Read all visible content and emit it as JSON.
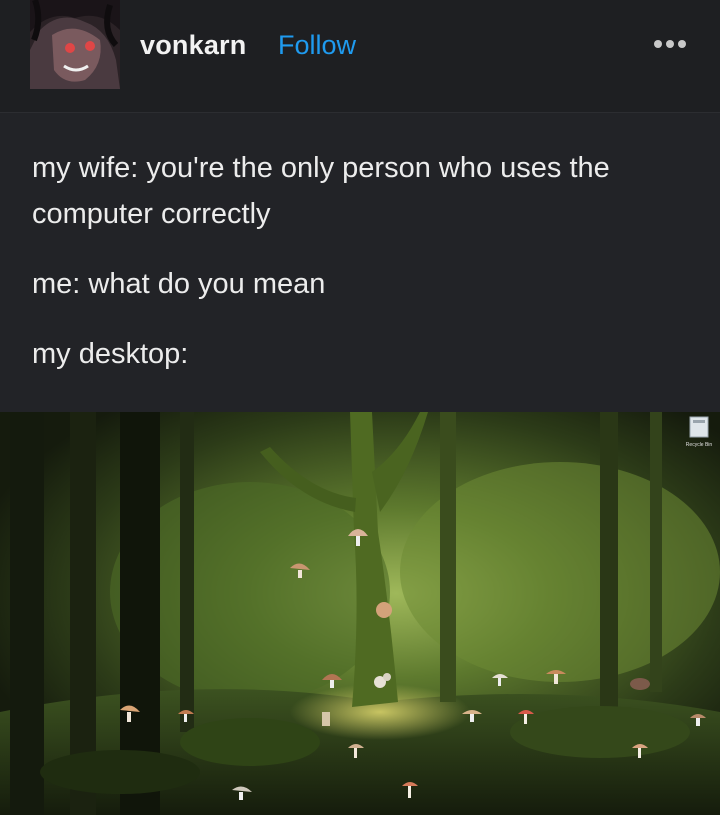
{
  "post": {
    "username": "vonkarn",
    "follow_label": "Follow",
    "more_icon": "ellipsis-icon",
    "lines": [
      "my wife: you're the only person who uses the computer correctly",
      "me: what do you mean",
      "my desktop:"
    ]
  },
  "desktop": {
    "recycle_bin_label": "Recycle Bin",
    "icon_type": "mushroom-icon",
    "colors": {
      "accent": "#1f9bf0",
      "background": "#222327"
    }
  }
}
